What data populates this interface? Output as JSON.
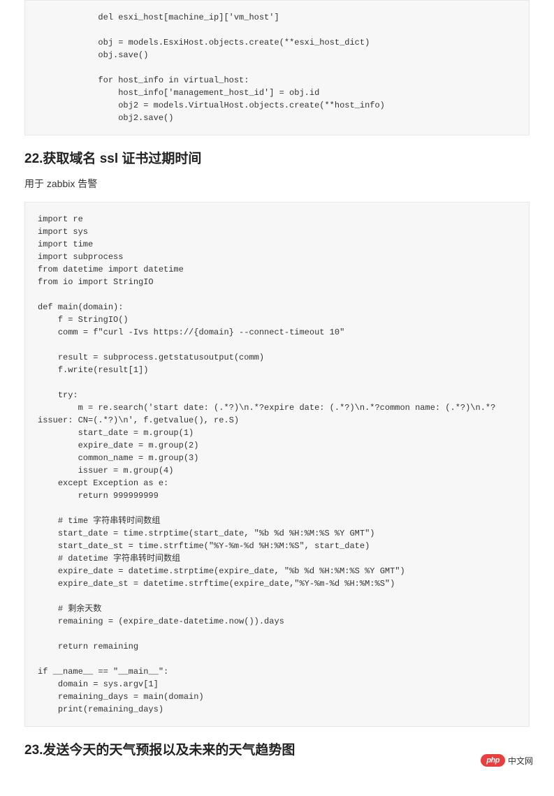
{
  "code_block_1": "            del esxi_host[machine_ip]['vm_host']\n\n            obj = models.EsxiHost.objects.create(**esxi_host_dict)\n            obj.save()\n\n            for host_info in virtual_host:\n                host_info['management_host_id'] = obj.id\n                obj2 = models.VirtualHost.objects.create(**host_info)\n                obj2.save()",
  "heading_22": "22.获取域名 ssl 证书过期时间",
  "paragraph_1": "用于 zabbix 告警",
  "code_block_2": "import re\nimport sys\nimport time\nimport subprocess\nfrom datetime import datetime\nfrom io import StringIO\n\ndef main(domain):\n    f = StringIO()\n    comm = f\"curl -Ivs https://{domain} --connect-timeout 10\"\n\n    result = subprocess.getstatusoutput(comm)\n    f.write(result[1])\n\n    try:\n        m = re.search('start date: (.*?)\\n.*?expire date: (.*?)\\n.*?common name: (.*?)\\n.*?issuer: CN=(.*?)\\n', f.getvalue(), re.S)\n        start_date = m.group(1)\n        expire_date = m.group(2)\n        common_name = m.group(3)\n        issuer = m.group(4)\n    except Exception as e:\n        return 999999999\n\n    # time 字符串转时间数组\n    start_date = time.strptime(start_date, \"%b %d %H:%M:%S %Y GMT\")\n    start_date_st = time.strftime(\"%Y-%m-%d %H:%M:%S\", start_date)\n    # datetime 字符串转时间数组\n    expire_date = datetime.strptime(expire_date, \"%b %d %H:%M:%S %Y GMT\")\n    expire_date_st = datetime.strftime(expire_date,\"%Y-%m-%d %H:%M:%S\")\n\n    # 剩余天数\n    remaining = (expire_date-datetime.now()).days\n\n    return remaining\n\nif __name__ == \"__main__\":\n    domain = sys.argv[1]\n    remaining_days = main(domain)\n    print(remaining_days)",
  "heading_23": "23.发送今天的天气预报以及未来的天气趋势图",
  "watermark": {
    "logo": "php",
    "text": "中文网"
  }
}
